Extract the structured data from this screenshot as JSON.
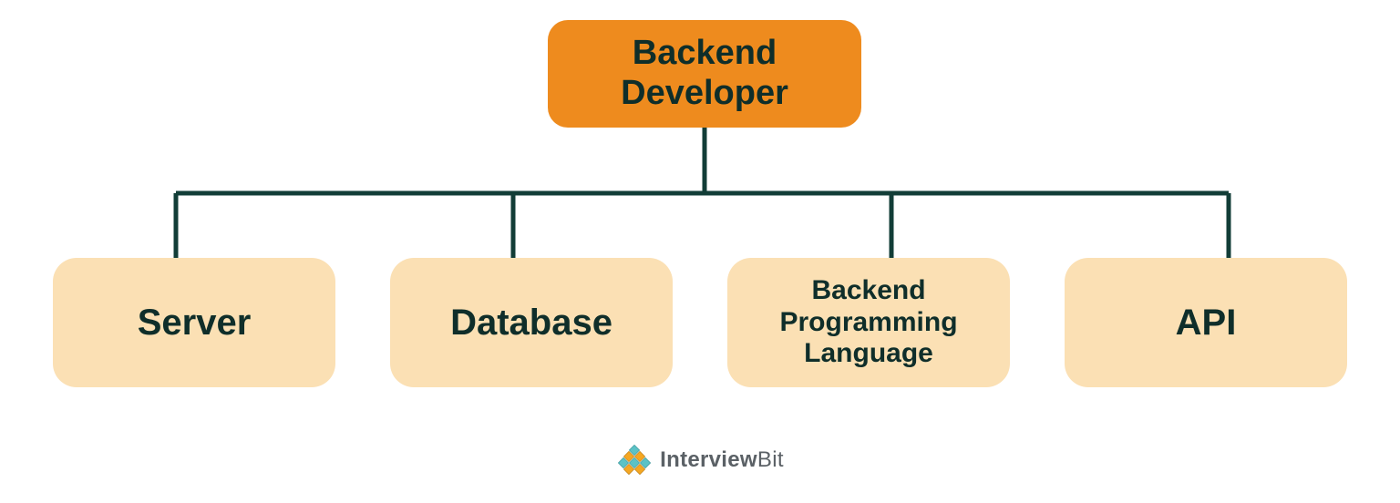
{
  "diagram": {
    "root": {
      "label": "Backend Developer"
    },
    "children": [
      {
        "label": "Server"
      },
      {
        "label": "Database"
      },
      {
        "label": "Backend Programming Language"
      },
      {
        "label": "API"
      }
    ]
  },
  "footer": {
    "brand_bold": "Interview",
    "brand_light": "Bit"
  },
  "colors": {
    "root_bg": "#ee8b1e",
    "child_bg": "#fbe0b4",
    "text": "#0f2e2a",
    "connector": "#123d37"
  }
}
